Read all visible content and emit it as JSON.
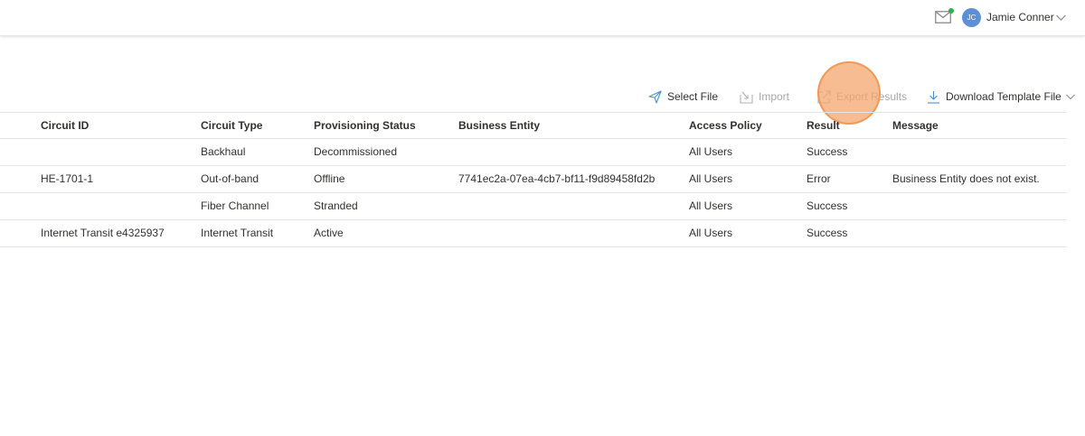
{
  "header": {
    "user_initials": "JC",
    "user_name": "Jamie Conner",
    "icons": {
      "mail": "mail-icon",
      "chevron": "chevron-down-icon"
    },
    "notification_color": "#2fb344",
    "avatar_color": "#5b8fd6"
  },
  "toolbar": {
    "select_file": "Select File",
    "import": "Import",
    "export_results": "Export Results",
    "download_template": "Download Template File"
  },
  "table": {
    "columns": [
      "Circuit ID",
      "Circuit Type",
      "Provisioning Status",
      "Business Entity",
      "Access Policy",
      "Result",
      "Message"
    ],
    "rows": [
      {
        "circuit_id": "",
        "circuit_type": "Backhaul",
        "status": "Decommissioned",
        "business_entity": "",
        "access_policy": "All Users",
        "result": "Success",
        "message": ""
      },
      {
        "circuit_id": "HE-1701-1",
        "circuit_type": "Out-of-band",
        "status": "Offline",
        "business_entity": "7741ec2a-07ea-4cb7-bf11-f9d89458fd2b",
        "access_policy": "All Users",
        "result": "Error",
        "message": "Business Entity does not exist."
      },
      {
        "circuit_id": "",
        "circuit_type": "Fiber Channel",
        "status": "Stranded",
        "business_entity": "",
        "access_policy": "All Users",
        "result": "Success",
        "message": ""
      },
      {
        "circuit_id": "Internet Transit e4325937",
        "circuit_type": "Internet Transit",
        "status": "Active",
        "business_entity": "",
        "access_policy": "All Users",
        "result": "Success",
        "message": ""
      }
    ]
  }
}
